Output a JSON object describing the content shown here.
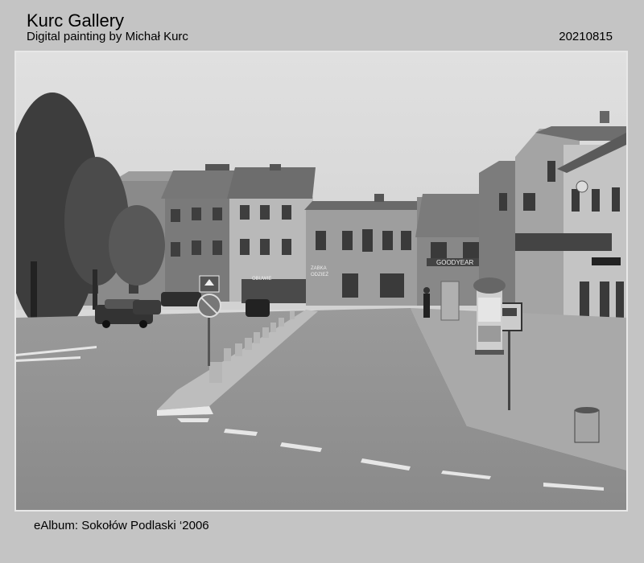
{
  "header": {
    "title": "Kurc Gallery",
    "subtitle": "Digital painting by Michał Kurc",
    "date": "20210815"
  },
  "photo": {
    "signs": {
      "goodyear": "GOODYEAR",
      "shop_1": "ZABKA",
      "shop_2": "ODZIEŻ",
      "shop_3": "OBUWIE"
    }
  },
  "footer": {
    "caption": "eAlbum: Sokołów Podlaski ‘2006"
  }
}
